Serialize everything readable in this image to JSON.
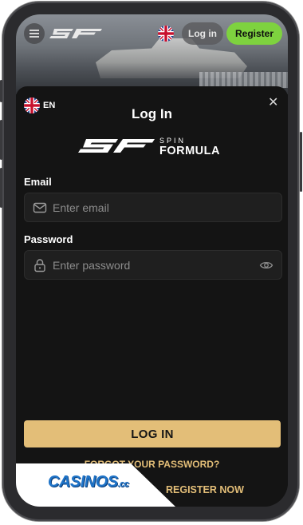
{
  "header": {
    "menu_icon": "hamburger-menu-icon",
    "logo_alt": "SF",
    "language_flag": "uk-flag-icon",
    "login_label": "Log in",
    "register_label": "Register",
    "register_color": "#7ed23f"
  },
  "modal": {
    "language": {
      "flag": "uk-flag-icon",
      "label": "EN"
    },
    "close_icon": "close-icon",
    "title": "Log In",
    "brand": {
      "mark": "SF",
      "line1": "SPIN",
      "line2": "FORMULA"
    },
    "email": {
      "label": "Email",
      "placeholder": "Enter email",
      "value": "",
      "icon": "envelope-icon"
    },
    "password": {
      "label": "Password",
      "placeholder": "Enter password",
      "value": "",
      "icon": "lock-icon",
      "toggle_icon": "eye-icon"
    },
    "login_button": "LOG IN",
    "forgot_link": "FORGOT YOUR PASSWORD?",
    "register_link": "REGISTER NOW",
    "accent_color": "#e3be78"
  },
  "watermark": {
    "text": "CASINOS",
    "suffix": ".cc"
  }
}
